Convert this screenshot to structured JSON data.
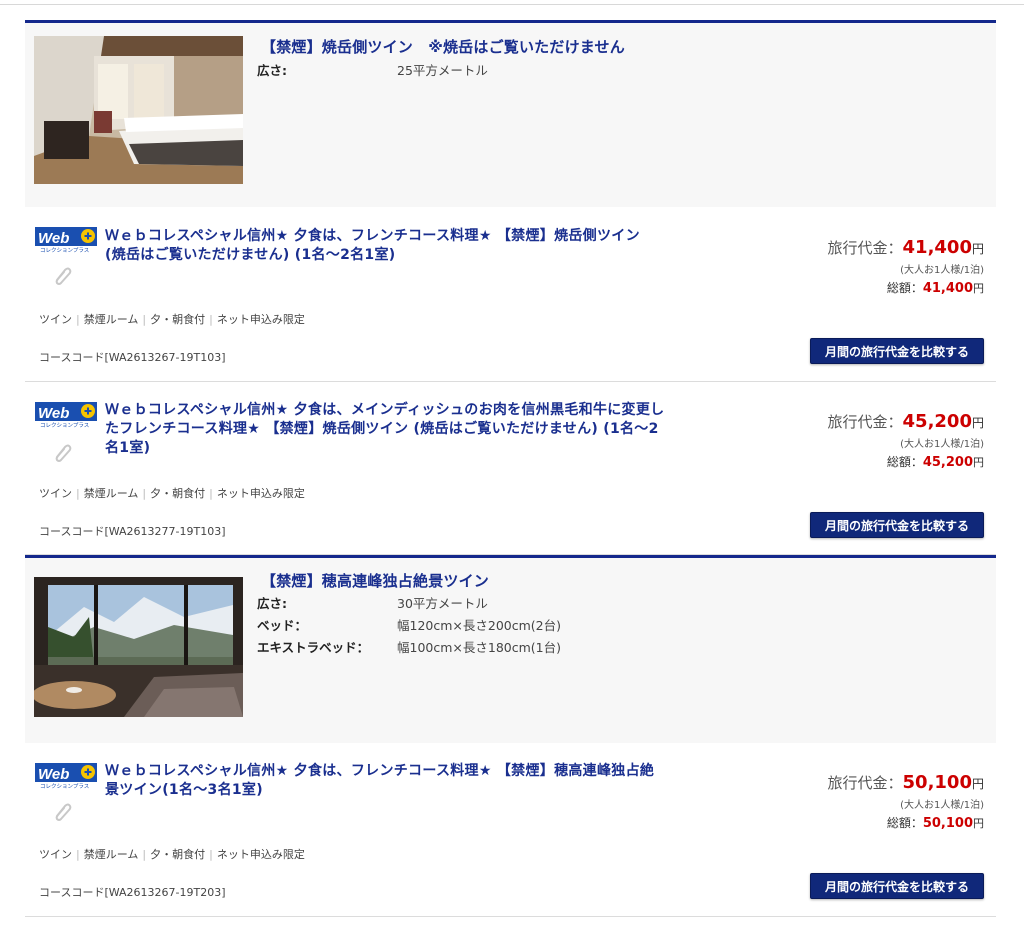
{
  "rooms": [
    {
      "title": "【禁煙】焼岳側ツイン　※焼岳はご覧いただけません",
      "specs": [
        {
          "label": "広さ:",
          "value": "25平方メートル"
        }
      ],
      "plans": [
        {
          "logo": "Web+ collection plus logo",
          "title": "Ｗｅｂコレスペシャル信州★ 夕食は、フレンチコース料理★ 【禁煙】焼岳側ツイン (焼岳はご覧いただけません) (1名～2名1室)",
          "tags": [
            "ツイン",
            "禁煙ルーム",
            "夕・朝食付",
            "ネット申込み限定"
          ],
          "code": "コースコード[WA2613267-19T103]",
          "price_label": "旅行代金：",
          "price": "41,400",
          "yen": "円",
          "price_note": "(大人お1人様/1泊)",
          "total_label": "総額：",
          "total": "41,400",
          "compare_button": "月間の旅行代金を比較する"
        },
        {
          "logo": "Web+ collection plus logo",
          "title": "Ｗｅｂコレスペシャル信州★ 夕食は、メインディッシュのお肉を信州黒毛和牛に変更したフレンチコース料理★ 【禁煙】焼岳側ツイン (焼岳はご覧いただけません) (1名～2名1室)",
          "tags": [
            "ツイン",
            "禁煙ルーム",
            "夕・朝食付",
            "ネット申込み限定"
          ],
          "code": "コースコード[WA2613277-19T103]",
          "price_label": "旅行代金：",
          "price": "45,200",
          "yen": "円",
          "price_note": "(大人お1人様/1泊)",
          "total_label": "総額：",
          "total": "45,200",
          "compare_button": "月間の旅行代金を比較する"
        }
      ]
    },
    {
      "title": "【禁煙】穂高連峰独占絶景ツイン",
      "specs": [
        {
          "label": "広さ:",
          "value": "30平方メートル"
        },
        {
          "label": "ベッド：",
          "value": "幅120cm×長さ200cm(2台)"
        },
        {
          "label": "エキストラベッド：",
          "value": "幅100cm×長さ180cm(1台)"
        }
      ],
      "plans": [
        {
          "logo": "Web+ collection plus logo",
          "title": "Ｗｅｂコレスペシャル信州★ 夕食は、フレンチコース料理★ 【禁煙】穂高連峰独占絶景ツイン(1名～3名1室)",
          "tags": [
            "ツイン",
            "禁煙ルーム",
            "夕・朝食付",
            "ネット申込み限定"
          ],
          "code": "コースコード[WA2613267-19T203]",
          "price_label": "旅行代金：",
          "price": "50,100",
          "yen": "円",
          "price_note": "(大人お1人様/1泊)",
          "total_label": "総額：",
          "total": "50,100",
          "compare_button": "月間の旅行代金を比較する"
        }
      ]
    }
  ],
  "colors": {
    "navy": "#14288c",
    "price_red": "#cc0000",
    "button": "#10287a"
  }
}
